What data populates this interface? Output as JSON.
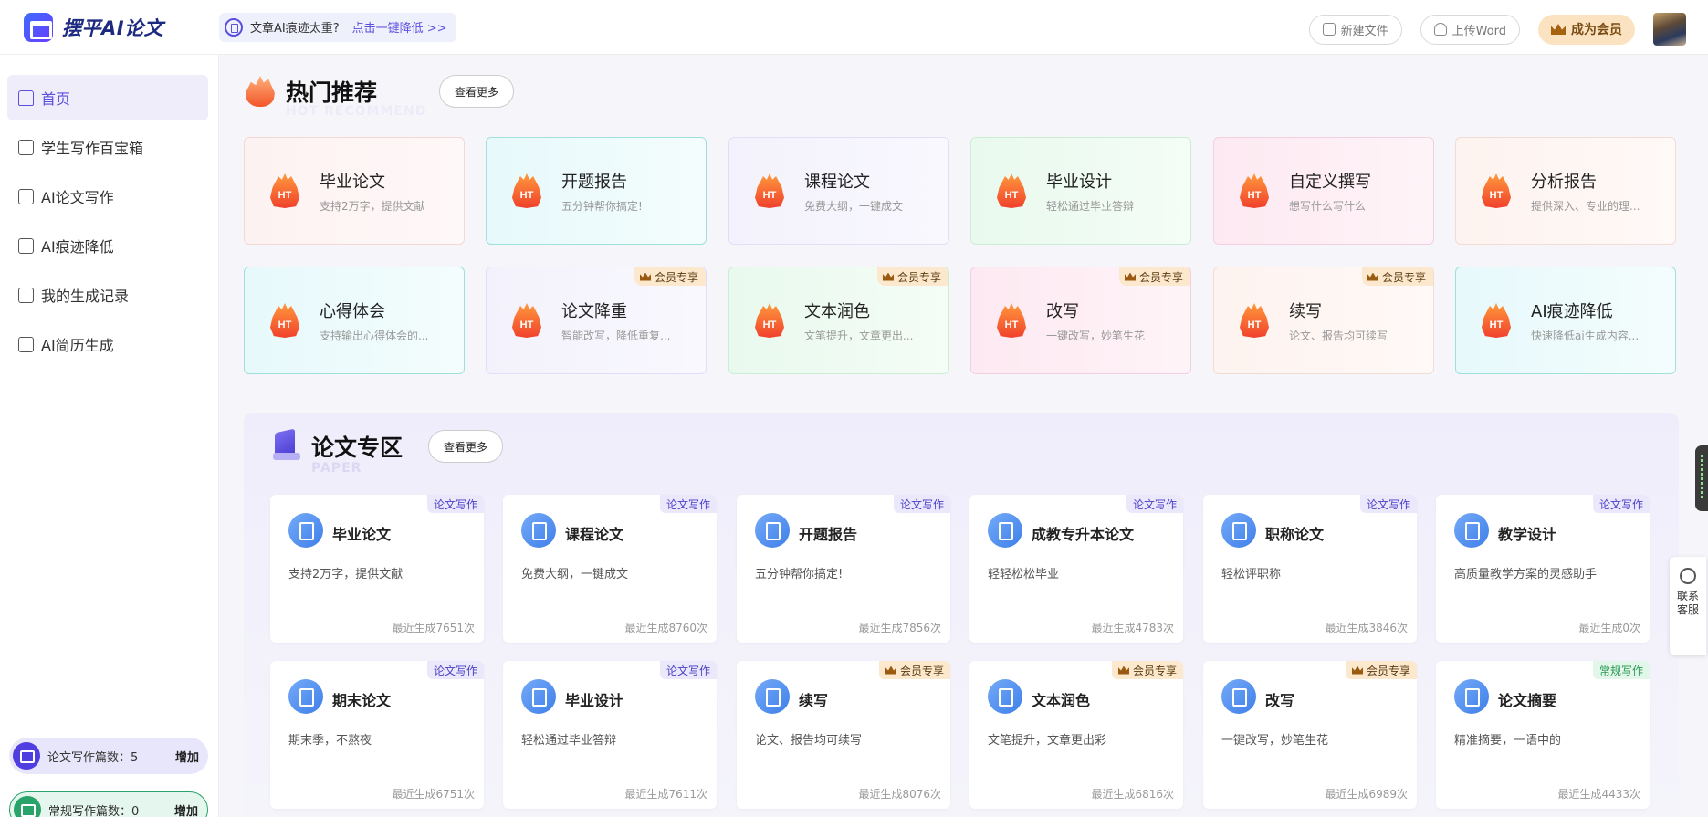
{
  "header": {
    "logo_text": "摆平AI论文",
    "promo_text": "文章AI痕迹太重?",
    "promo_link": "点击一键降低 >>",
    "new_file": "新建文件",
    "upload_word": "上传Word",
    "vip": "成为会员"
  },
  "sidebar": {
    "items": [
      {
        "label": "首页",
        "icon": "home-icon"
      },
      {
        "label": "学生写作百宝箱",
        "icon": "ai-doc-icon"
      },
      {
        "label": "AI论文写作",
        "icon": "ai-doc-icon"
      },
      {
        "label": "AI痕迹降低",
        "icon": "ai-chart-icon"
      },
      {
        "label": "我的生成记录",
        "icon": "record-icon"
      },
      {
        "label": "AI简历生成",
        "icon": "resume-icon"
      }
    ],
    "quota1": {
      "label": "论文写作篇数：",
      "count": "5",
      "action": "增加"
    },
    "quota2": {
      "label": "常规写作篇数：",
      "count": "0",
      "action": "增加"
    }
  },
  "hot": {
    "title": "热门推荐",
    "sub": "HOT RECOMMEND",
    "more": "查看更多",
    "badge": "HT",
    "vip_tag": "会员专享",
    "cards": [
      {
        "title": "毕业论文",
        "desc": "支持2万字，提供文献",
        "vip": false
      },
      {
        "title": "开题报告",
        "desc": "五分钟帮你搞定!",
        "vip": false
      },
      {
        "title": "课程论文",
        "desc": "免费大纲，一键成文",
        "vip": false
      },
      {
        "title": "毕业设计",
        "desc": "轻松通过毕业答辩",
        "vip": false
      },
      {
        "title": "自定义撰写",
        "desc": "想写什么写什么",
        "vip": false
      },
      {
        "title": "分析报告",
        "desc": "提供深入、专业的理...",
        "vip": false
      },
      {
        "title": "心得体会",
        "desc": "支持输出心得体会的...",
        "vip": false
      },
      {
        "title": "论文降重",
        "desc": "智能改写，降低重复...",
        "vip": true
      },
      {
        "title": "文本润色",
        "desc": "文笔提升，文章更出...",
        "vip": true
      },
      {
        "title": "改写",
        "desc": "一键改写，妙笔生花",
        "vip": true
      },
      {
        "title": "续写",
        "desc": "论文、报告均可续写",
        "vip": true
      },
      {
        "title": "AI痕迹降低",
        "desc": "快速降低ai生成内容...",
        "vip": false
      }
    ]
  },
  "paper": {
    "title": "论文专区",
    "sub": "PAPER",
    "more": "查看更多",
    "cards": [
      {
        "title": "毕业论文",
        "desc": "支持2万字，提供文献",
        "stat": "最近生成7651次",
        "tag": "论文写作"
      },
      {
        "title": "课程论文",
        "desc": "免费大纲，一键成文",
        "stat": "最近生成8760次",
        "tag": "论文写作"
      },
      {
        "title": "开题报告",
        "desc": "五分钟帮你搞定!",
        "stat": "最近生成7856次",
        "tag": "论文写作"
      },
      {
        "title": "成教专升本论文",
        "desc": "轻轻松松毕业",
        "stat": "最近生成4783次",
        "tag": "论文写作"
      },
      {
        "title": "职称论文",
        "desc": "轻松评职称",
        "stat": "最近生成3846次",
        "tag": "论文写作"
      },
      {
        "title": "教学设计",
        "desc": "高质量教学方案的灵感助手",
        "stat": "最近生成0次",
        "tag": "论文写作"
      },
      {
        "title": "期末论文",
        "desc": "期末季，不熬夜",
        "stat": "最近生成6751次",
        "tag": "论文写作"
      },
      {
        "title": "毕业设计",
        "desc": "轻松通过毕业答辩",
        "stat": "最近生成7611次",
        "tag": "论文写作"
      },
      {
        "title": "续写",
        "desc": "论文、报告均可续写",
        "stat": "最近生成8076次",
        "tag": "会员专享"
      },
      {
        "title": "文本润色",
        "desc": "文笔提升，文章更出彩",
        "stat": "最近生成6816次",
        "tag": "会员专享"
      },
      {
        "title": "改写",
        "desc": "一键改写，妙笔生花",
        "stat": "最近生成6989次",
        "tag": "会员专享"
      },
      {
        "title": "论文摘要",
        "desc": "精准摘要，一语中的",
        "stat": "最近生成4433次",
        "tag": "常规写作"
      }
    ]
  },
  "service": {
    "label": "联系客服"
  }
}
